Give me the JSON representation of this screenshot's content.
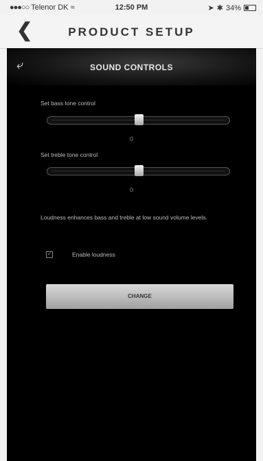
{
  "status_bar": {
    "carrier": "Telenor DK",
    "time": "12:50 PM",
    "battery": "34%"
  },
  "nav": {
    "title": "PRODUCT SETUP",
    "back_icon": "chevron-left-icon"
  },
  "panel": {
    "heading": "SOUND CONTROLS",
    "undo_icon": "undo-icon"
  },
  "bass": {
    "label": "Set bass tone control",
    "value": "0",
    "level": 0.5
  },
  "treble": {
    "label": "Set treble tone control",
    "value": "0",
    "level": 0.5
  },
  "loudness": {
    "note": "Loudness enhances bass and treble at low sound volume levels.",
    "checkbox_label": "Enable loudness",
    "checked": true
  },
  "change_button": "CHANGE"
}
